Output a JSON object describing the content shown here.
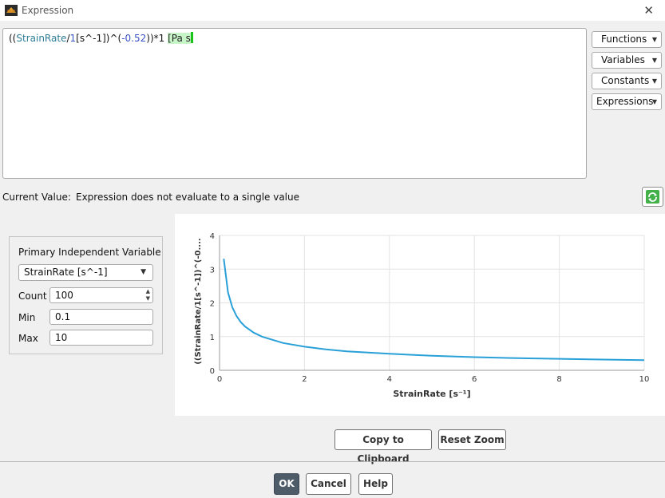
{
  "window": {
    "title": "Expression"
  },
  "expression": {
    "open": "((",
    "var": "StrainRate",
    "op1": "/",
    "num1": "1",
    "unit1": "[s^-1]",
    "close1": ")^(",
    "num2": "-0.52",
    "close2": "))",
    "op2": "*1 ",
    "unit2": "[Pa s",
    "unit2_tail": "]"
  },
  "side_buttons": {
    "functions": "Functions",
    "variables": "Variables",
    "constants": "Constants",
    "expressions": "Expressions"
  },
  "current_value": {
    "label": "Current Value:",
    "value": "Expression does not evaluate to a single value"
  },
  "piv": {
    "title": "Primary Independent Variable",
    "selected": "StrainRate [s^-1]",
    "count_label": "Count",
    "count": "100",
    "min_label": "Min",
    "min": "0.1",
    "max_label": "Max",
    "max": "10"
  },
  "chart_data": {
    "type": "line",
    "xlabel": "StrainRate [s⁻¹]",
    "ylabel": "((StrainRate/1[s^-1])^(-0....",
    "xlim": [
      0,
      10
    ],
    "ylim": [
      0,
      4
    ],
    "xticks": [
      "0",
      "2",
      "4",
      "6",
      "8",
      "10"
    ],
    "yticks": [
      "0",
      "1",
      "2",
      "3",
      "4"
    ],
    "grid": true,
    "line_color": "#2aa0d8",
    "series": [
      {
        "x": [
          0.1,
          0.2,
          0.3,
          0.4,
          0.5,
          0.6,
          0.8,
          1,
          1.5,
          2,
          2.5,
          3,
          4,
          5,
          6,
          7,
          8,
          9,
          10
        ],
        "y": [
          3.31,
          2.31,
          1.87,
          1.61,
          1.43,
          1.3,
          1.12,
          1.0,
          0.81,
          0.7,
          0.62,
          0.56,
          0.49,
          0.43,
          0.39,
          0.36,
          0.34,
          0.32,
          0.3
        ]
      }
    ]
  },
  "plot_buttons": {
    "copy": "Copy to Clipboard",
    "reset": "Reset Zoom"
  },
  "footer": {
    "ok": "OK",
    "cancel": "Cancel",
    "help": "Help"
  }
}
